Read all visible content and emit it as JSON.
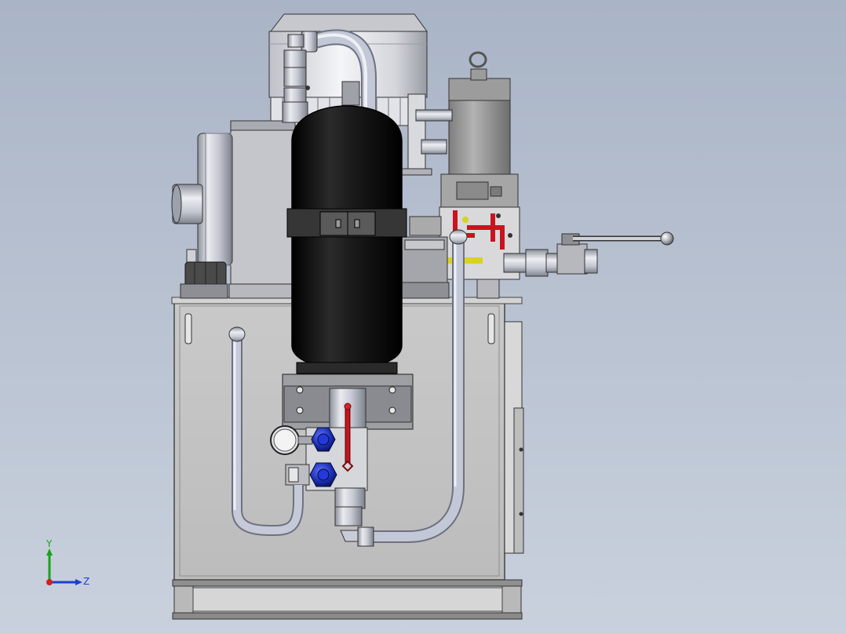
{
  "viewport": {
    "background_top": "#a9b4c6",
    "background_bottom": "#c9d1dd"
  },
  "triad": {
    "y_label": "Y",
    "z_label": "Z",
    "x_color": "#d21e1e",
    "y_color": "#17a317",
    "z_color": "#1c3fcf"
  },
  "model": {
    "icon": "hydraulic-power-unit",
    "accent_colors": {
      "accumulator": "#0d0d0d",
      "handle_red": "#c8141e",
      "valve_blue": "#1b2fb5",
      "pipe_steel": "#c3c8d6",
      "pipe_yellow": "#d7d320"
    }
  }
}
